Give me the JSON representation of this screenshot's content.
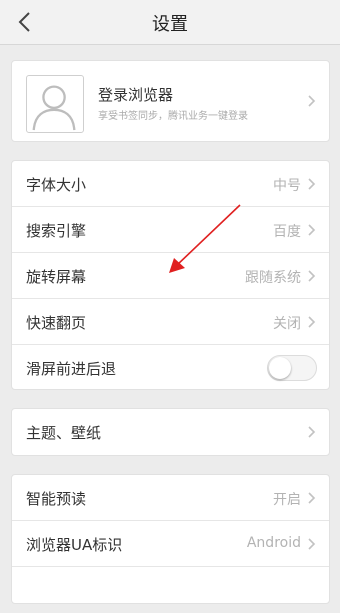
{
  "header": {
    "title": "设置"
  },
  "account": {
    "title": "登录浏览器",
    "subtitle": "享受书签同步，腾讯业务一键登录"
  },
  "group1": [
    {
      "label": "字体大小",
      "value": "中号"
    },
    {
      "label": "搜索引擎",
      "value": "百度"
    },
    {
      "label": "旋转屏幕",
      "value": "跟随系统"
    },
    {
      "label": "快速翻页",
      "value": "关闭"
    },
    {
      "label": "滑屏前进后退",
      "toggle": false
    }
  ],
  "group2": [
    {
      "label": "主题、壁纸"
    }
  ],
  "group3": [
    {
      "label": "智能预读",
      "value": "开启"
    },
    {
      "label": "浏览器UA标识",
      "value": "Android"
    },
    {
      "label": "",
      "value": ""
    }
  ],
  "annotation_color": "#e02020"
}
